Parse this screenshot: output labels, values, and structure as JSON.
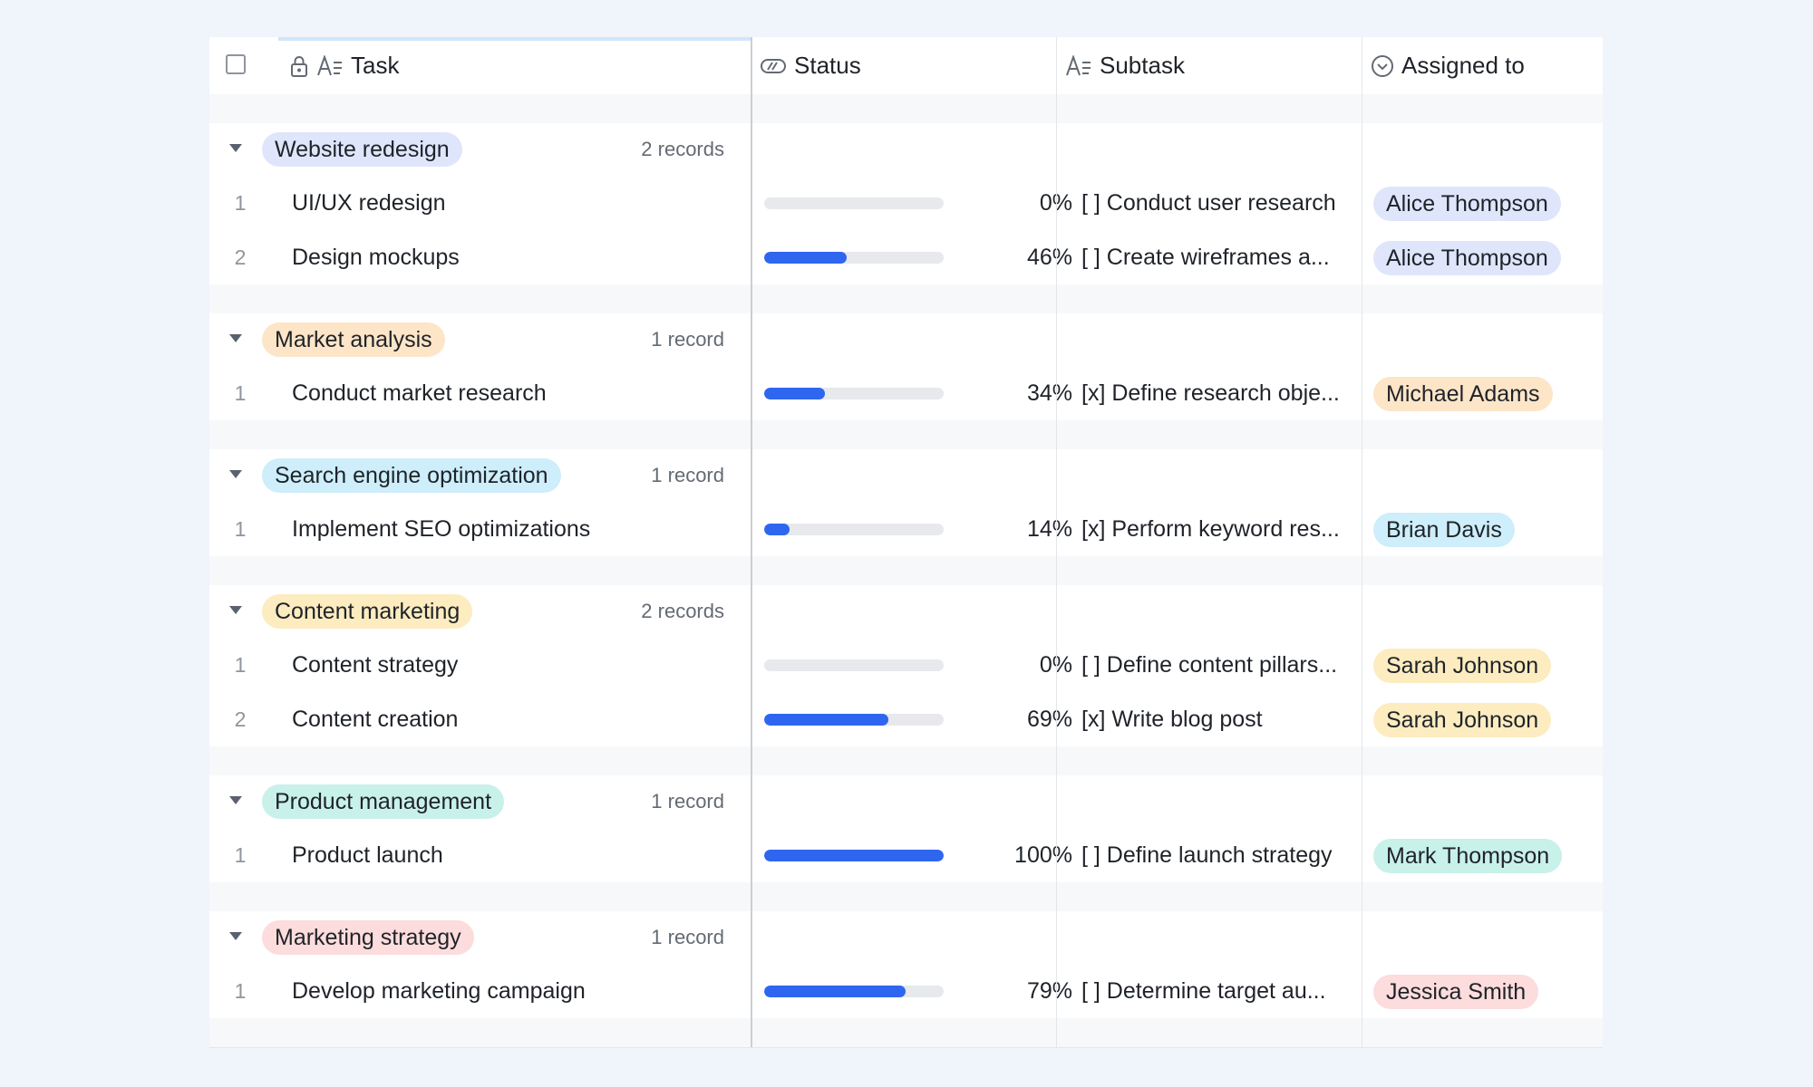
{
  "header": {
    "task_label": "Task",
    "status_label": "Status",
    "subtask_label": "Subtask",
    "assigned_label": "Assigned to"
  },
  "colors": {
    "progress_fill": "#2f66f0",
    "progress_track": "#e7e9ec",
    "purple": "#dfe6fb",
    "orange": "#fde5c8",
    "cyan": "#cdeefa",
    "yellow": "#fcecc0",
    "teal": "#c8f1ea",
    "pink": "#fcdcdc"
  },
  "groups": [
    {
      "name": "Website redesign",
      "count": "2 records",
      "color": "purple",
      "records": [
        {
          "num": "1",
          "task": "UI/UX redesign",
          "progress": 0,
          "pct": "0%",
          "subtask": "[ ] Conduct user research",
          "assignee": "Alice Thompson"
        },
        {
          "num": "2",
          "task": "Design mockups",
          "progress": 46,
          "pct": "46%",
          "subtask": "[ ] Create wireframes a...",
          "assignee": "Alice Thompson"
        }
      ]
    },
    {
      "name": "Market analysis",
      "count": "1 record",
      "color": "orange",
      "records": [
        {
          "num": "1",
          "task": "Conduct market research",
          "progress": 34,
          "pct": "34%",
          "subtask": "[x] Define research obje...",
          "assignee": "Michael Adams"
        }
      ]
    },
    {
      "name": "Search engine optimization",
      "count": "1 record",
      "color": "cyan",
      "records": [
        {
          "num": "1",
          "task": "Implement SEO optimizations",
          "progress": 14,
          "pct": "14%",
          "subtask": "[x] Perform keyword res...",
          "assignee": "Brian Davis"
        }
      ]
    },
    {
      "name": "Content marketing",
      "count": "2 records",
      "color": "yellow",
      "records": [
        {
          "num": "1",
          "task": "Content strategy",
          "progress": 0,
          "pct": "0%",
          "subtask": "[ ] Define content pillars...",
          "assignee": "Sarah Johnson"
        },
        {
          "num": "2",
          "task": "Content creation",
          "progress": 69,
          "pct": "69%",
          "subtask": "[x] Write blog post",
          "assignee": "Sarah Johnson"
        }
      ]
    },
    {
      "name": "Product management",
      "count": "1 record",
      "color": "teal",
      "records": [
        {
          "num": "1",
          "task": "Product launch",
          "progress": 100,
          "pct": "100%",
          "subtask": "[ ] Define launch strategy",
          "assignee": "Mark Thompson"
        }
      ]
    },
    {
      "name": "Marketing strategy",
      "count": "1 record",
      "color": "pink",
      "records": [
        {
          "num": "1",
          "task": "Develop marketing campaign",
          "progress": 79,
          "pct": "79%",
          "subtask": "[ ] Determine target au...",
          "assignee": "Jessica Smith"
        }
      ]
    }
  ]
}
